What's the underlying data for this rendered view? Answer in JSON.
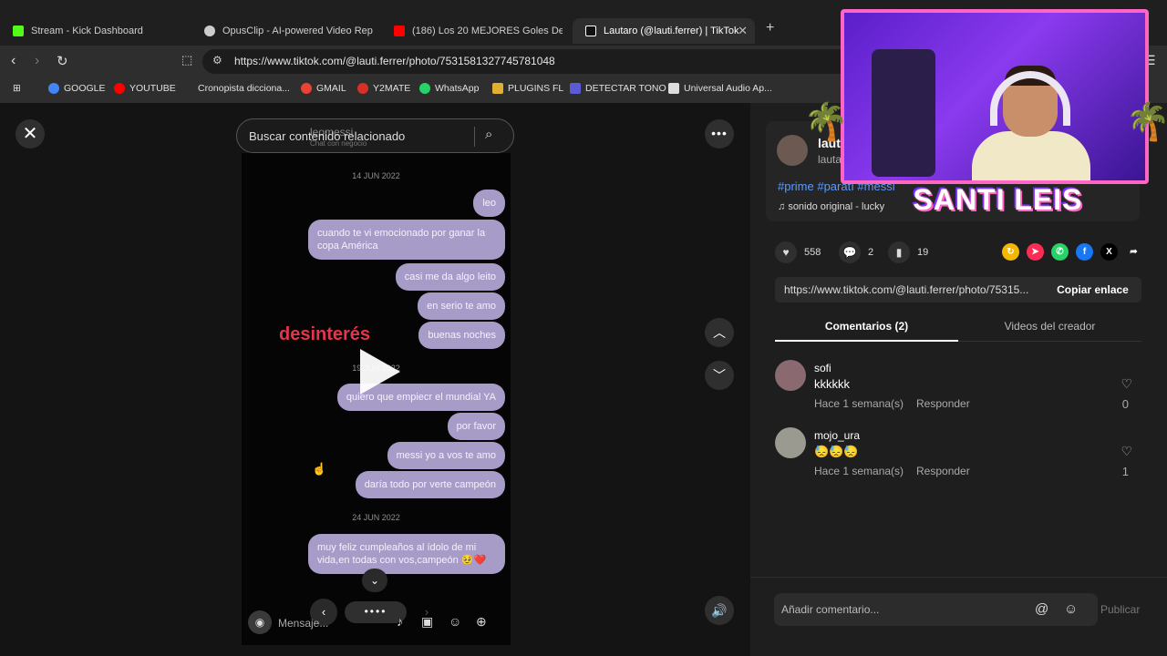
{
  "browser": {
    "tabs": [
      {
        "title": "Stream - Kick Dashboard",
        "color": "#53fc18"
      },
      {
        "title": "OpusClip - AI-powered Video Repurp",
        "color": "#cccccc"
      },
      {
        "title": "(186) Los 20 MEJORES Goles De Lion",
        "color": "#ff0000"
      },
      {
        "title": "Lautaro (@lauti.ferrer) | TikTok",
        "color": "#ffffff"
      }
    ],
    "url": "https://www.tiktok.com/@lauti.ferrer/photo/7531581327745781048",
    "bookmarks": [
      {
        "label": "GOOGLE",
        "color": "#4285f4"
      },
      {
        "label": "YOUTUBE",
        "color": "#ff0000"
      },
      {
        "label": "Cronopista diccionа...",
        "color": "#cccccc"
      },
      {
        "label": "GMAIL",
        "color": "#ea4335"
      },
      {
        "label": "Y2MATE",
        "color": "#d93025"
      },
      {
        "label": "WhatsApp",
        "color": "#25d366"
      },
      {
        "label": "PLUGINS FL",
        "color": "#e0b030"
      },
      {
        "label": "DETECTAR TONO",
        "color": "#5b5bd6"
      },
      {
        "label": "Universal Audio Ap...",
        "color": "#dddddd"
      }
    ]
  },
  "viewer": {
    "search_label": "Buscar contenido relacionado",
    "ghost_name": "leomessi",
    "ghost_sub": "Chat con negocio",
    "overlay_text": "desinterés",
    "message_placeholder": "Mensaje...",
    "dates": [
      "14 JUN 2022",
      "19 JUN 2022",
      "24 JUN 2022"
    ],
    "messages": [
      "leo",
      "cuando te vi emocionado por ganar la copa América",
      "casi me da algo leito",
      "en serio te amo",
      "buenas noches",
      "quiero que empiecr el mundial YA",
      "por favor",
      "messi yo a vos te amo",
      "daría todo por verte campeón",
      "muy feliz cumpleaños al ídolo de mi vida,en todas con vos,campeón 🥹❤️"
    ]
  },
  "sidebar": {
    "author_name": "lauti",
    "author_handle": "lauta",
    "tags": "#prime #paratí #messi",
    "sound": "sonido original - lucky",
    "likes": "558",
    "comments": "2",
    "saves": "19",
    "link": "https://www.tiktok.com/@lauti.ferrer/photo/75315...",
    "copy_label": "Copiar enlace",
    "tab_comments": "Comentarios (2)",
    "tab_videos": "Videos del creador",
    "comment_list": [
      {
        "user": "sofi",
        "text": "kkkkkk",
        "time": "Hace 1 semana(s)",
        "reply": "Responder",
        "likes": "0"
      },
      {
        "user": "mojo_ura",
        "text": "😓😓😓",
        "time": "Hace 1 semana(s)",
        "reply": "Responder",
        "likes": "1"
      }
    ],
    "add_comment_placeholder": "Añadir comentario...",
    "publish_label": "Publicar"
  },
  "overlay": {
    "streamer_name": "SANTI LEIS"
  }
}
